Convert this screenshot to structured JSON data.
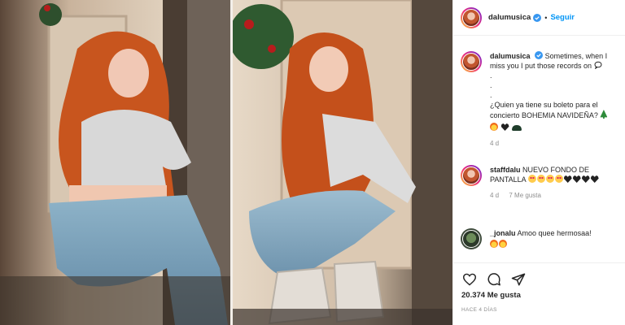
{
  "post": {
    "username": "dalumusica",
    "follow_label": "Seguir",
    "separator": "•"
  },
  "caption": {
    "username": "dalumusica",
    "text_1": "Sometimes, when I miss you I put those records on",
    "dots": [
      ".",
      ".",
      "."
    ],
    "text_2": "¿Quien ya tiene su boleto para el concierto BOHEMIA NAVIDEÑA?",
    "age": "4 d"
  },
  "comments": [
    {
      "username": "staffdalu",
      "text": "NUEVO FONDO DE PANTALLA",
      "age": "4 d",
      "likes": "7 Me gusta"
    },
    {
      "username": "_jonalu",
      "text": "Amoo quee hermosaa!"
    }
  ],
  "actions": {
    "likes_count": "20.374 Me gusta",
    "posted": "HACE 4 DÍAS"
  },
  "icons": {
    "like": "heart-icon",
    "comment": "comment-icon",
    "share": "share-icon",
    "verified": "verified-badge-icon"
  },
  "colors": {
    "accent": "#0095f6",
    "verified": "#3897f0",
    "muted": "#8e8e8e"
  }
}
